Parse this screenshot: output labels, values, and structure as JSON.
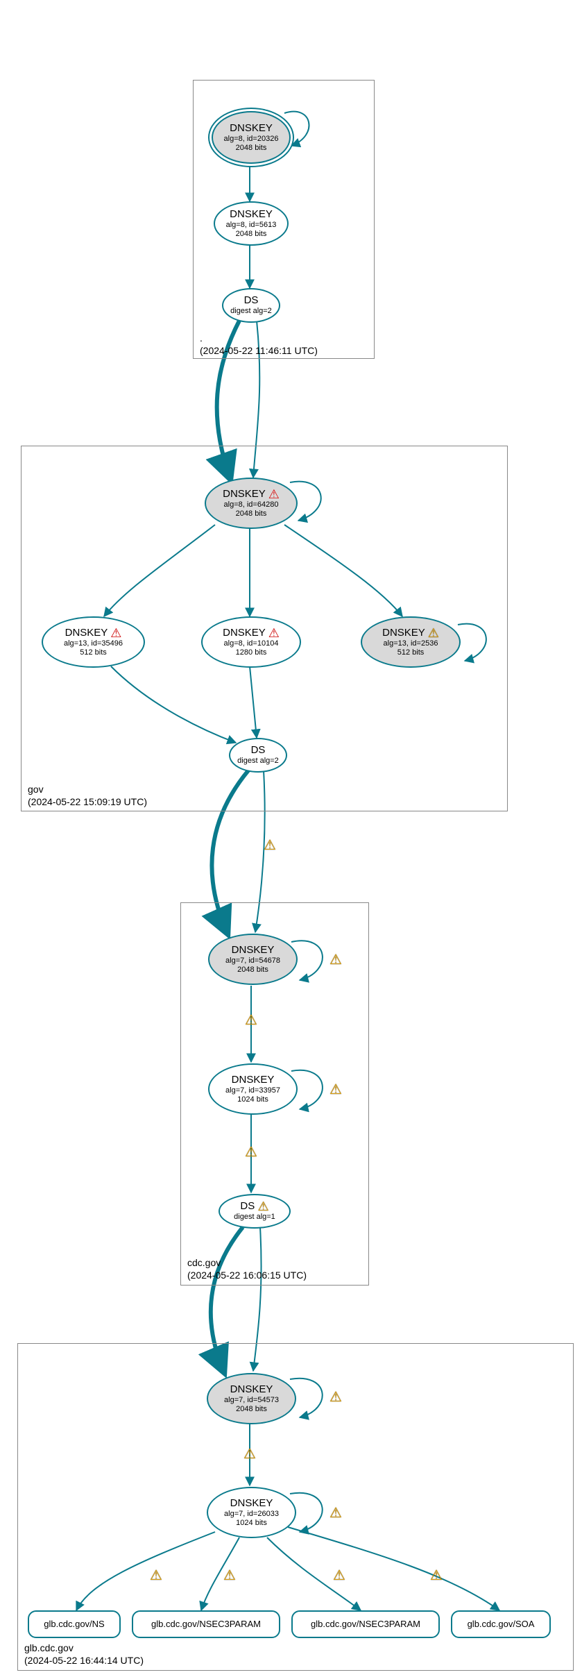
{
  "colors": {
    "stroke": "#0a7a8c",
    "box": "#888888",
    "gray_fill": "#d9d9d9",
    "warn_red": "#cc0000",
    "warn_yellow": "#e8a500"
  },
  "zones": [
    {
      "id": "root",
      "label": ".",
      "timestamp": "(2024-05-22 11:46:11 UTC)"
    },
    {
      "id": "gov",
      "label": "gov",
      "timestamp": "(2024-05-22 15:09:19 UTC)"
    },
    {
      "id": "cdc",
      "label": "cdc.gov",
      "timestamp": "(2024-05-22 16:06:15 UTC)"
    },
    {
      "id": "glb",
      "label": "glb.cdc.gov",
      "timestamp": "(2024-05-22 16:44:14 UTC)"
    }
  ],
  "nodes": {
    "root_ksk": {
      "title": "DNSKEY",
      "line2": "alg=8, id=20326",
      "line3": "2048 bits",
      "warn": null
    },
    "root_zsk": {
      "title": "DNSKEY",
      "line2": "alg=8, id=5613",
      "line3": "2048 bits",
      "warn": null
    },
    "root_ds": {
      "title": "DS",
      "line2": "digest alg=2",
      "line3": null,
      "warn": null
    },
    "gov_ksk": {
      "title": "DNSKEY",
      "line2": "alg=8, id=64280",
      "line3": "2048 bits",
      "warn": "red"
    },
    "gov_k1": {
      "title": "DNSKEY",
      "line2": "alg=13, id=35496",
      "line3": "512 bits",
      "warn": "red"
    },
    "gov_k2": {
      "title": "DNSKEY",
      "line2": "alg=8, id=10104",
      "line3": "1280 bits",
      "warn": "red"
    },
    "gov_k3": {
      "title": "DNSKEY",
      "line2": "alg=13, id=2536",
      "line3": "512 bits",
      "warn": "yellow"
    },
    "gov_ds": {
      "title": "DS",
      "line2": "digest alg=2",
      "line3": null,
      "warn": null
    },
    "cdc_ksk": {
      "title": "DNSKEY",
      "line2": "alg=7, id=54678",
      "line3": "2048 bits",
      "warn": null
    },
    "cdc_zsk": {
      "title": "DNSKEY",
      "line2": "alg=7, id=33957",
      "line3": "1024 bits",
      "warn": null
    },
    "cdc_ds": {
      "title": "DS",
      "line2": "digest alg=1",
      "line3": null,
      "warn": "yellow"
    },
    "glb_ksk": {
      "title": "DNSKEY",
      "line2": "alg=7, id=54573",
      "line3": "2048 bits",
      "warn": null
    },
    "glb_zsk": {
      "title": "DNSKEY",
      "line2": "alg=7, id=26033",
      "line3": "1024 bits",
      "warn": null
    },
    "glb_ns": {
      "title": "glb.cdc.gov/NS"
    },
    "glb_nsec1": {
      "title": "glb.cdc.gov/NSEC3PARAM"
    },
    "glb_nsec2": {
      "title": "glb.cdc.gov/NSEC3PARAM"
    },
    "glb_soa": {
      "title": "glb.cdc.gov/SOA"
    }
  },
  "edge_warnings": [
    {
      "from": "root_ds",
      "to": "gov_ksk",
      "type": "yellow"
    }
  ],
  "chart_data": {
    "type": "table",
    "description": "DNSSEC trust chain graph",
    "edges": [
      [
        "root_ksk",
        "root_ksk",
        "self"
      ],
      [
        "root_ksk",
        "root_zsk",
        ""
      ],
      [
        "root_zsk",
        "root_ds",
        ""
      ],
      [
        "root_ds",
        "gov_ksk",
        "warn"
      ],
      [
        "gov_ksk",
        "gov_ksk",
        "self"
      ],
      [
        "gov_ksk",
        "gov_k1",
        ""
      ],
      [
        "gov_ksk",
        "gov_k2",
        ""
      ],
      [
        "gov_ksk",
        "gov_k3",
        ""
      ],
      [
        "gov_k3",
        "gov_k3",
        "self"
      ],
      [
        "gov_k1",
        "gov_ds",
        ""
      ],
      [
        "gov_k2",
        "gov_ds",
        ""
      ],
      [
        "gov_ds",
        "cdc_ksk",
        "warn"
      ],
      [
        "cdc_ksk",
        "cdc_ksk",
        "self-warn"
      ],
      [
        "cdc_ksk",
        "cdc_zsk",
        "warn"
      ],
      [
        "cdc_zsk",
        "cdc_zsk",
        "self-warn"
      ],
      [
        "cdc_zsk",
        "cdc_ds",
        "warn"
      ],
      [
        "cdc_ds",
        "glb_ksk",
        ""
      ],
      [
        "glb_ksk",
        "glb_ksk",
        "self-warn"
      ],
      [
        "glb_ksk",
        "glb_zsk",
        "warn"
      ],
      [
        "glb_zsk",
        "glb_zsk",
        "self-warn"
      ],
      [
        "glb_zsk",
        "glb_ns",
        "warn"
      ],
      [
        "glb_zsk",
        "glb_nsec1",
        "warn"
      ],
      [
        "glb_zsk",
        "glb_nsec2",
        "warn"
      ],
      [
        "glb_zsk",
        "glb_soa",
        "warn"
      ]
    ]
  }
}
